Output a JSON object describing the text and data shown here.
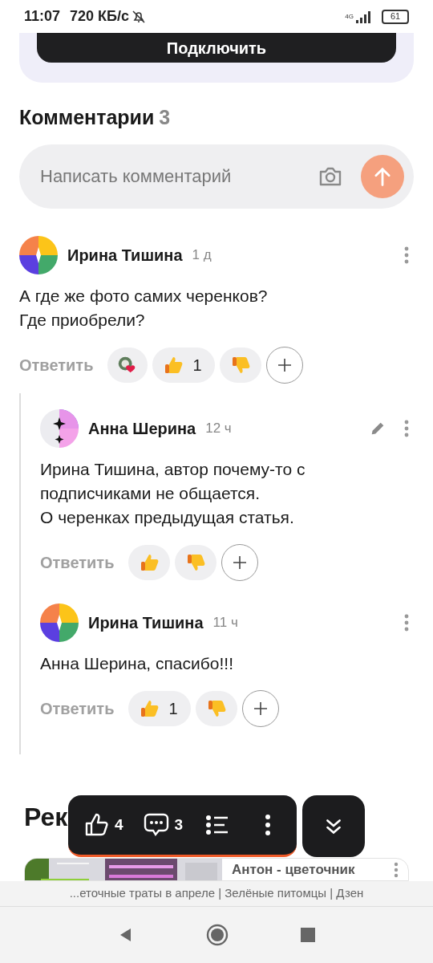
{
  "status_bar": {
    "time": "11:07",
    "speed": "720 КБ/с",
    "network": "4G",
    "battery": "61"
  },
  "promo": {
    "button": "Подключить"
  },
  "comments_header": {
    "title": "Комментарии",
    "count": "3"
  },
  "comment_input": {
    "placeholder": "Написать комментарий"
  },
  "comments": [
    {
      "author": "Ирина Тишина",
      "kind": "multicolor",
      "time": "1 д",
      "text": "А где же фото самих черенков?\nГде приобрели?",
      "editable": false,
      "reply": "Ответить",
      "reactions": [
        {
          "kind": "sticker"
        },
        {
          "kind": "like",
          "count": "1"
        },
        {
          "kind": "dislike"
        },
        {
          "kind": "add"
        }
      ],
      "children": [
        {
          "author": "Анна Шерина",
          "kind": "star",
          "time": "12 ч",
          "text": "Ирина Тишина, автор почему-то с\nподписчиками не общается.\nО черенках предыдущая статья.",
          "editable": true,
          "reply": "Ответить",
          "reactions": [
            {
              "kind": "like"
            },
            {
              "kind": "dislike"
            },
            {
              "kind": "add"
            }
          ]
        },
        {
          "author": "Ирина Тишина",
          "kind": "multicolor",
          "time": "11 ч",
          "text": "Анна Шерина, спасибо!!!",
          "editable": false,
          "reply": "Ответить",
          "reactions": [
            {
              "kind": "like",
              "count": "1"
            },
            {
              "kind": "dislike"
            },
            {
              "kind": "add"
            }
          ]
        }
      ]
    }
  ],
  "recommendations": {
    "heading": "Рек",
    "card": {
      "channel": "Антон - цветочник"
    }
  },
  "floating_bar": {
    "likes": "4",
    "comments": "3"
  },
  "url_bar": {
    "title": "...еточные траты в апреле | Зелёные питомцы | Дзен"
  }
}
